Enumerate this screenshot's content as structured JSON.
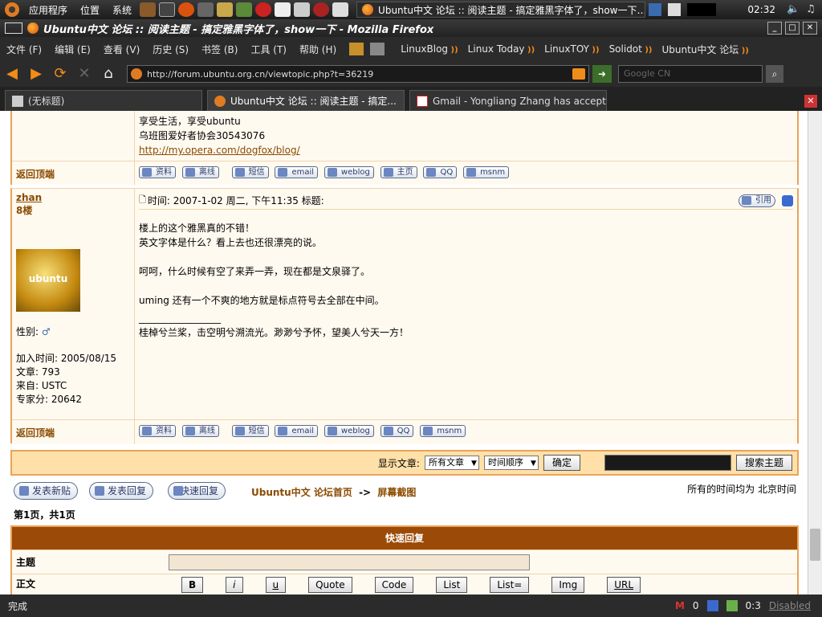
{
  "panel": {
    "menus": [
      "应用程序",
      "位置",
      "系统"
    ],
    "task_title": "Ubuntu中文 论坛 :: 阅读主题 - 搞定雅黑字体了，show一下…",
    "clock": "02:32"
  },
  "window": {
    "title": "Ubuntu中文 论坛 :: 阅读主题 - 搞定雅黑字体了，show一下 - Mozilla Firefox"
  },
  "menubar": {
    "menus": [
      "文件 (F)",
      "编辑 (E)",
      "查看 (V)",
      "历史 (S)",
      "书签 (B)",
      "工具 (T)",
      "帮助 (H)"
    ],
    "bookmarks": [
      "LinuxBlog",
      "Linux Today",
      "LinuxTOY",
      "Solidot",
      "Ubuntu中文 论坛"
    ]
  },
  "nav": {
    "url": "http://forum.ubuntu.org.cn/viewtopic.php?t=36219",
    "search_placeholder": "Google CN"
  },
  "tabs": [
    {
      "label": "(无标题)"
    },
    {
      "label": "Ubuntu中文 论坛 :: 阅读主题 - 搞定..."
    },
    {
      "label": "Gmail - Yongliang Zhang has accepted ..."
    }
  ],
  "prev_post": {
    "sig_lines": [
      "享受生活，享受ubuntu",
      "乌班图爱好者协会30543076"
    ],
    "sig_link": "http://my.opera.com/dogfox/blog/",
    "back_to_top": "返回顶端",
    "buttons": [
      "资料",
      "离线",
      "短信",
      "email",
      "weblog",
      "主页",
      "QQ",
      "msnm"
    ]
  },
  "post": {
    "author": "zhan",
    "floor": "8楼",
    "gender_label": "性别:",
    "joined": "加入时间: 2005/08/15",
    "posts": "文章: 793",
    "from": "来自: USTC",
    "expert": "专家分: 20642",
    "meta": "时间: 2007-1-02 周二, 下午11:35    标题:",
    "quote_btn": "引用",
    "lines": [
      "楼上的这个雅黑真的不错！",
      "英文字体是什么？看上去也还很漂亮的说。",
      "",
      "呵呵，什么时候有空了来弄一弄，现在都是文泉驿了。",
      "",
      "uming 还有一个不爽的地方就是标点符号去全部在中间。"
    ],
    "sig_rule": "_________________",
    "signature": "桂棹兮兰桨，击空明兮溯流光。渺渺兮予怀，望美人兮天一方！",
    "back_to_top": "返回顶端",
    "buttons": [
      "资料",
      "离线",
      "短信",
      "email",
      "weblog",
      "QQ",
      "msnm"
    ]
  },
  "viewbar": {
    "label": "显示文章:",
    "filter": "所有文章",
    "order": "时间顺序",
    "ok": "确定",
    "search_btn": "搜索主题"
  },
  "actions": {
    "new_topic": "发表新贴",
    "reply": "发表回复",
    "quick_reply": "快速回复",
    "crumb_home": "Ubuntu中文 论坛首页",
    "crumb_sep": "->",
    "crumb_forum": "屏幕截图",
    "timezone": "所有的时间均为 北京时间",
    "pagination": "第1页，共1页"
  },
  "quickreply": {
    "header": "快速回复",
    "subject_label": "主题",
    "body_label": "正文",
    "tools": [
      "B",
      "i",
      "u",
      "Quote",
      "Code",
      "List",
      "List=",
      "Img",
      "URL"
    ]
  },
  "status": {
    "text": "完成",
    "mail_count": "0",
    "timer": "0:3",
    "disabled": "Disabled"
  }
}
